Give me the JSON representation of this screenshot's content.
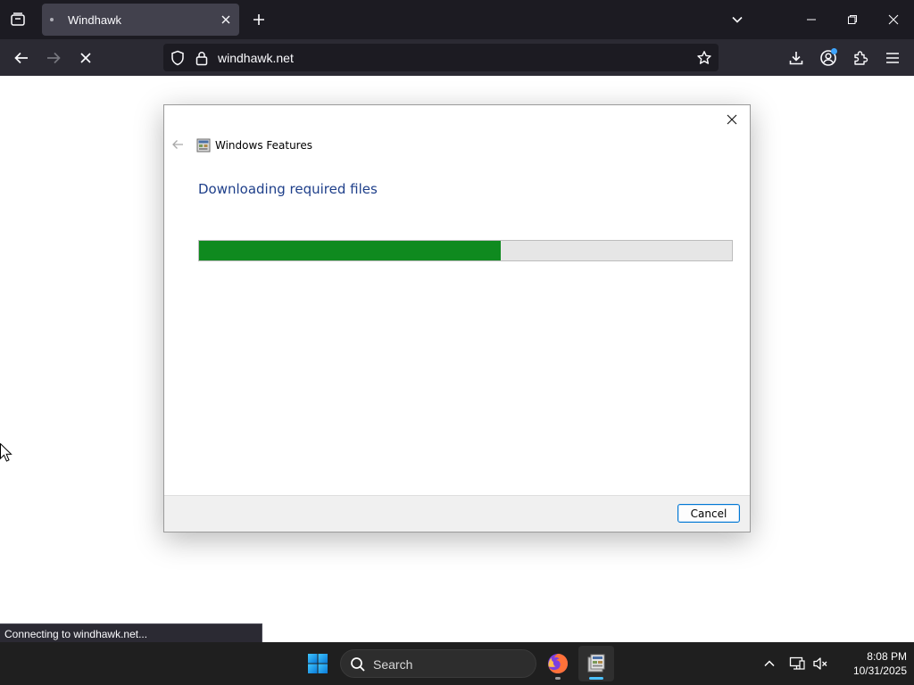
{
  "browser": {
    "tab_title": "Windhawk",
    "url": "windhawk.net",
    "status_text": "Connecting to windhawk.net..."
  },
  "dialog": {
    "title": "Windows Features",
    "heading": "Downloading required files",
    "progress_fraction": 0.567,
    "progress_color": "#0f8a1f",
    "cancel_label": "Cancel"
  },
  "taskbar": {
    "search_label": "Search",
    "time": "8:08 PM",
    "date": "10/31/2025"
  }
}
